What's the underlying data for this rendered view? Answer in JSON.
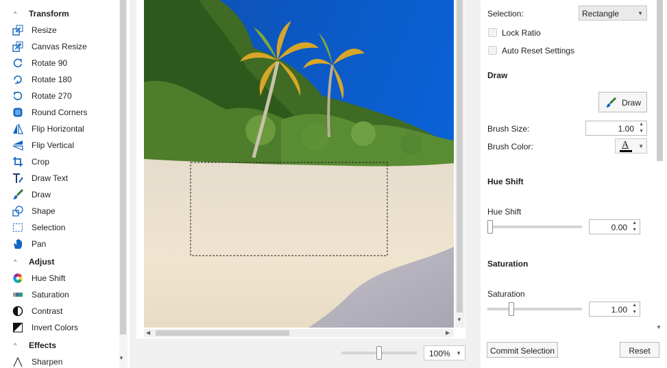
{
  "sidebar": {
    "groups": [
      {
        "label": "Transform",
        "chevron": "^",
        "items": [
          {
            "label": "Resize",
            "icon": "resize-icon"
          },
          {
            "label": "Canvas Resize",
            "icon": "canvas-resize-icon"
          },
          {
            "label": "Rotate 90",
            "icon": "rotate-90-icon"
          },
          {
            "label": "Rotate 180",
            "icon": "rotate-180-icon"
          },
          {
            "label": "Rotate 270",
            "icon": "rotate-270-icon"
          },
          {
            "label": "Round Corners",
            "icon": "round-corners-icon"
          },
          {
            "label": "Flip Horizontal",
            "icon": "flip-horizontal-icon"
          },
          {
            "label": "Flip Vertical",
            "icon": "flip-vertical-icon"
          },
          {
            "label": "Crop",
            "icon": "crop-icon"
          },
          {
            "label": "Draw Text",
            "icon": "draw-text-icon"
          },
          {
            "label": "Draw",
            "icon": "brush-icon"
          },
          {
            "label": "Shape",
            "icon": "shape-icon"
          },
          {
            "label": "Selection",
            "icon": "selection-icon"
          },
          {
            "label": "Pan",
            "icon": "hand-icon"
          }
        ]
      },
      {
        "label": "Adjust",
        "chevron": "^",
        "items": [
          {
            "label": "Hue Shift",
            "icon": "color-wheel-icon"
          },
          {
            "label": "Saturation",
            "icon": "saturation-icon"
          },
          {
            "label": "Contrast",
            "icon": "contrast-icon"
          },
          {
            "label": "Invert Colors",
            "icon": "invert-colors-icon"
          }
        ]
      },
      {
        "label": "Effects",
        "chevron": "^",
        "items": [
          {
            "label": "Sharpen",
            "icon": "sharpen-icon"
          }
        ]
      }
    ]
  },
  "viewer": {
    "zoom_value": "100%"
  },
  "settings": {
    "selection_label": "Selection:",
    "selection_value": "Rectangle",
    "lock_ratio_label": "Lock Ratio",
    "auto_reset_label": "Auto Reset Settings",
    "draw_header": "Draw",
    "draw_button": "Draw",
    "brush_size_label": "Brush Size:",
    "brush_size_value": "1.00",
    "brush_color_label": "Brush Color:",
    "brush_color_glyph": "A",
    "hue_header": "Hue Shift",
    "hue_label": "Hue Shift",
    "hue_value": "0.00",
    "saturation_header": "Saturation",
    "saturation_label": "Saturation",
    "saturation_value": "1.00",
    "commit_button": "Commit Selection",
    "reset_button": "Reset"
  },
  "colors": {
    "sky": "#0a57c4",
    "sand": "#eee3cf",
    "accent_blue": "#1565c0"
  }
}
